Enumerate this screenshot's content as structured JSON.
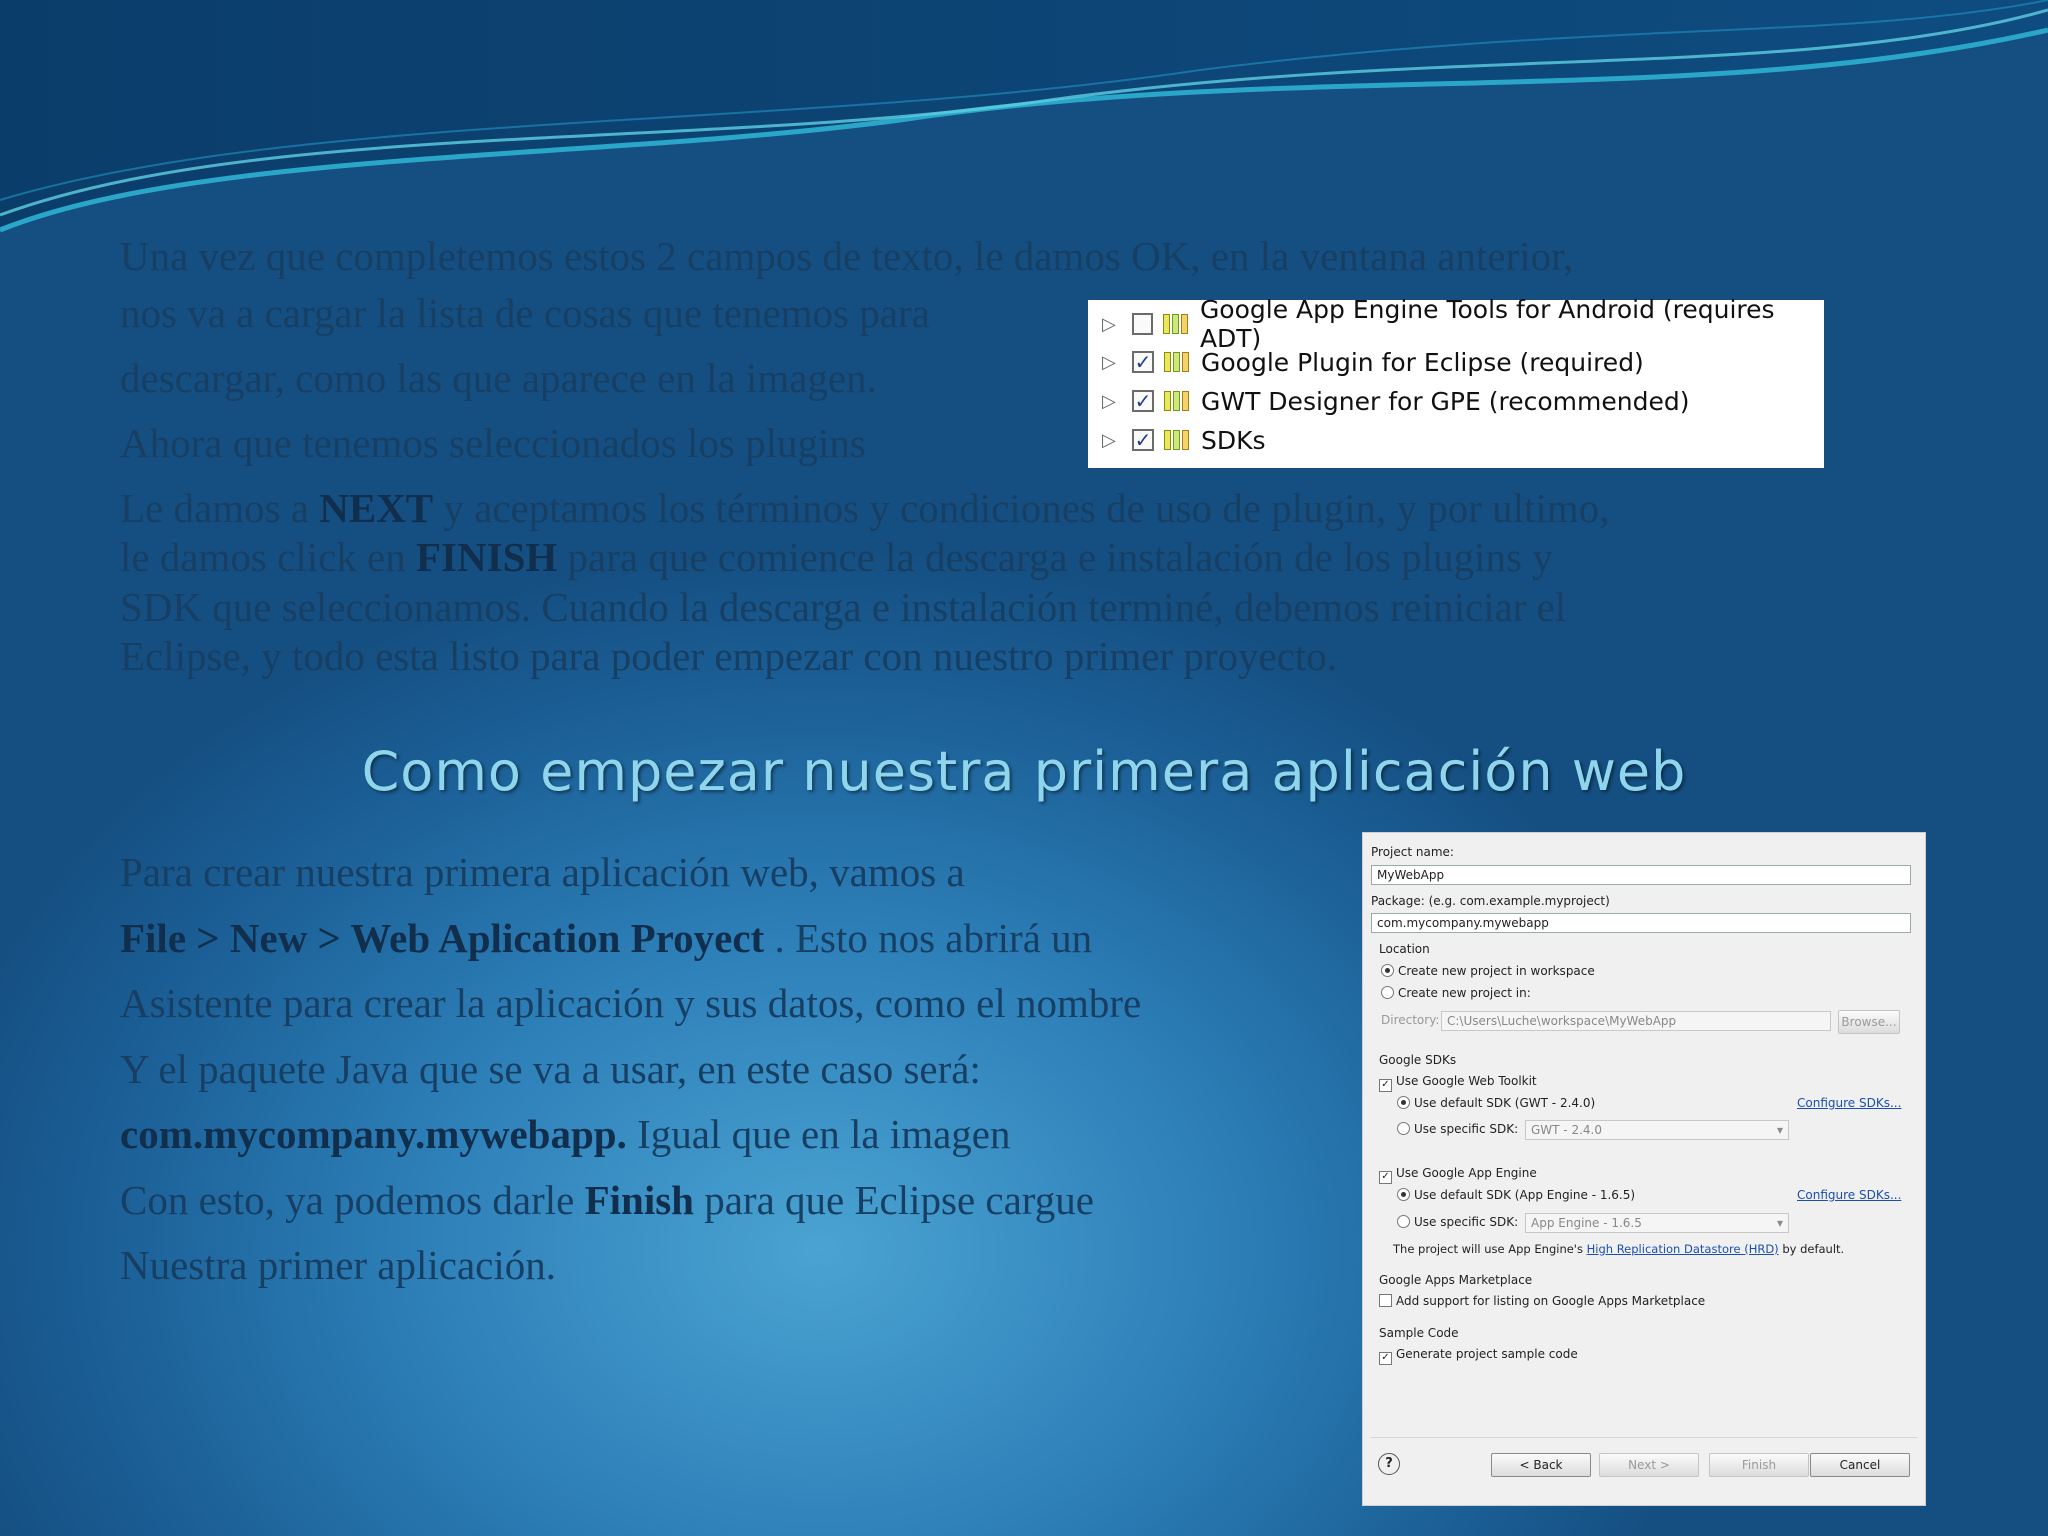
{
  "slide": {
    "para1": {
      "line1": "Una vez que completemos estos 2 campos de texto, le damos OK, en la ventana anterior,",
      "line2": "nos va a cargar la lista de cosas que tenemos para",
      "line3": "descargar, como las que aparece en la imagen.",
      "line4": "Ahora que tenemos seleccionados los plugins"
    },
    "para2": {
      "a": "Le damos a ",
      "next": "NEXT",
      "b": " y aceptamos los términos y condiciones de uso de plugin, y por ultimo,",
      "c": "le damos click en ",
      "finish": "FINISH",
      "d": " para que comience la descarga e instalación de los plugins y",
      "e": "SDK que seleccionamos. Cuando la descarga e instalación terminé, debemos reiniciar el",
      "f": "Eclipse, y todo esta listo para poder empezar con nuestro primer proyecto."
    },
    "heading": "Como empezar nuestra primera aplicación web",
    "para3": {
      "l1": "Para crear nuestra primera aplicación web, vamos a",
      "menu_path": "File > New > Web Aplication Proyect",
      "l2b": " . Esto nos abrirá un",
      "l3": "Asistente para crear la aplicación y sus datos, como el nombre",
      "l4": "Y el paquete Java que se va a usar, en este caso será:",
      "pkg": "com.mycompany.mywebapp.",
      "l5b": "  Igual que en la imagen",
      "l6a": "Con esto, ya podemos darle ",
      "finish": "Finish",
      "l6b": " para que Eclipse cargue",
      "l7": "Nuestra primer aplicación."
    }
  },
  "plugins": [
    {
      "label": "Google App Engine Tools for Android (requires ADT)",
      "checked": false,
      "icon": "feature-icon"
    },
    {
      "label": "Google Plugin for Eclipse (required)",
      "checked": true,
      "icon": "feature-icon"
    },
    {
      "label": "GWT Designer for GPE (recommended)",
      "checked": true,
      "icon": "feature-icon"
    },
    {
      "label": "SDKs",
      "checked": true,
      "icon": "feature-icon"
    }
  ],
  "wizard": {
    "project_name_label": "Project name:",
    "project_name_value": "MyWebApp",
    "package_label": "Package: (e.g. com.example.myproject)",
    "package_value": "com.mycompany.mywebapp",
    "location_label": "Location",
    "loc_opt1": "Create new project in workspace",
    "loc_opt2": "Create new project in:",
    "directory_label": "Directory:",
    "directory_value": "C:\\Users\\Luche\\workspace\\MyWebApp",
    "browse": "Browse...",
    "sdks_label": "Google SDKs",
    "use_gwt": "Use Google Web Toolkit",
    "gwt_default": "Use default SDK (GWT - 2.4.0)",
    "gwt_specific": "Use specific SDK:",
    "gwt_specific_value": "GWT - 2.4.0",
    "configure_sdks": "Configure SDKs...",
    "use_gae": "Use Google App Engine",
    "gae_default": "Use default SDK (App Engine - 1.6.5)",
    "gae_specific": "Use specific SDK:",
    "gae_specific_value": "App Engine - 1.6.5",
    "hrd_a": "The project will use App Engine's ",
    "hrd_link": "High Replication Datastore (HRD)",
    "hrd_b": " by default.",
    "marketplace_label": "Google Apps Marketplace",
    "marketplace_opt": "Add support for listing on Google Apps Marketplace",
    "sample_label": "Sample Code",
    "sample_opt": "Generate project sample code",
    "help": "?",
    "back": "< Back",
    "next": "Next >",
    "finish": "Finish",
    "cancel": "Cancel"
  },
  "colors": {
    "text": "#173f63",
    "heading": "#8fd6ec",
    "background": "#2d7fb8"
  }
}
